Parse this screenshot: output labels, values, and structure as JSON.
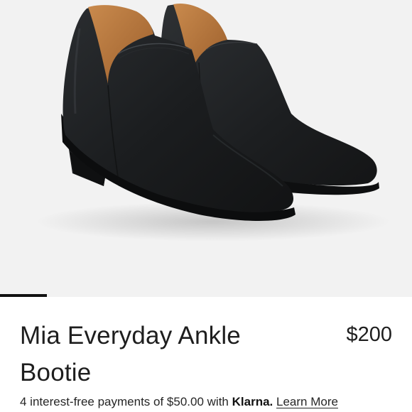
{
  "product": {
    "title": "Mia Everyday Ankle Bootie",
    "price": "$200"
  },
  "financing": {
    "text_before": "4 interest-free payments of $50.00 with",
    "provider": "Klarna.",
    "link_label": "Learn More"
  },
  "gallery": {
    "slide_current": 1
  },
  "colors": {
    "image_background": "#f2f2f2",
    "leather": "#1b1d1f",
    "lining": "#b8773f",
    "text": "#1e1e1e"
  }
}
